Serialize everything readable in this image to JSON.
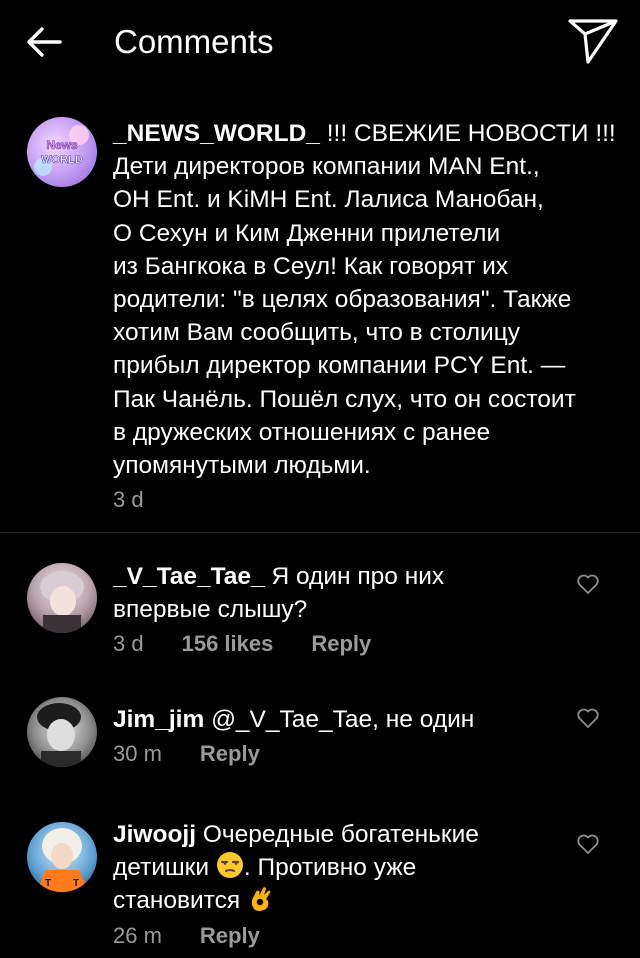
{
  "header": {
    "title": "Comments",
    "back_icon": "arrow-left-icon",
    "send_icon": "paper-plane-icon"
  },
  "caption": {
    "username": "_NEWS_WORLD_",
    "avatar_text_top": "News",
    "avatar_text_bottom": "WORLD",
    "lines": [
      "!!! СВЕЖИЕ НОВОСТИ !!!",
      "Дети директоров компании MAN Ent.,",
      "OH Ent. и KiMH Ent. Лалиса Манобан,",
      "О Сехун и Ким Дженни прилетели",
      "из Бангкока в Сеул! Как говорят их",
      "родители: \"в целях образования\". Также",
      "хотим Вам сообщить, что в столицу",
      "прибыл директор компании PCY Ent. —",
      "Пак Чанёль. Пошёл слух, что он состоит",
      "в дружеских отношениях с ранее",
      "упомянутыми людьми."
    ],
    "time": "3 d"
  },
  "comments": [
    {
      "username": "_V_Tae_Tae_",
      "line1": "Я один про них",
      "line2": "впервые слышу?",
      "time": "3 d",
      "likes": "156 likes",
      "reply": "Reply"
    },
    {
      "username": "Jim_jim",
      "line1": "@_V_Tae_Tae, не один",
      "time": "30 m",
      "reply": "Reply"
    },
    {
      "username": "Jiwoojj",
      "line1": "Очередные богатенькие",
      "line2a": "детишки",
      "line2b": ". Противно уже",
      "line3": "становится",
      "time": "26 m",
      "reply": "Reply"
    }
  ],
  "colors": {
    "background": "#000000",
    "text": "#ffffff",
    "meta": "#9a9a9a",
    "divider": "#2a2a2a"
  }
}
